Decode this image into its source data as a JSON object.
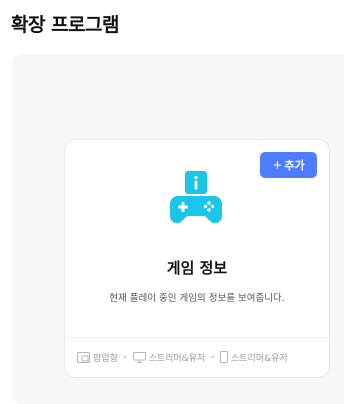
{
  "page": {
    "title": "확장 프로그램"
  },
  "extension": {
    "add_button": {
      "icon": "plus-icon",
      "label": "추가"
    },
    "icon": "gamepad-info-icon",
    "icon_color": "#19c6ea",
    "name": "게임 정보",
    "description": "현재 플레이 중인 게임의 정보를 보여줍니다.",
    "tags": [
      {
        "icon": "popup-window-icon",
        "label": "팝업형"
      },
      {
        "icon": "monitor-icon",
        "label": "스트리머&유저"
      },
      {
        "icon": "mobile-phone-icon",
        "label": "스트리머&유저"
      }
    ]
  },
  "colors": {
    "accent": "#4d7cff",
    "panel_bg": "#f7f7f8"
  }
}
